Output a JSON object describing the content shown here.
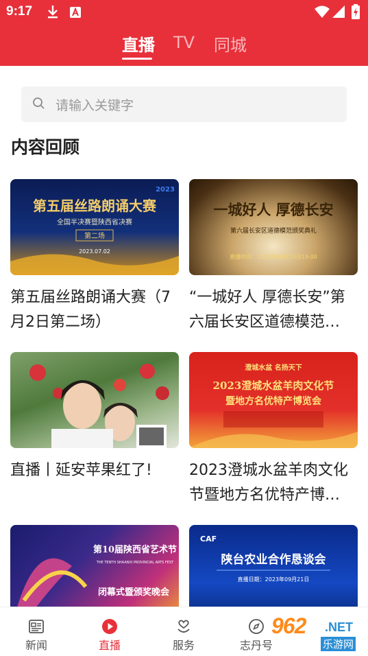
{
  "status_bar": {
    "time": "9:17"
  },
  "tabs": [
    {
      "label": "直播",
      "active": true
    },
    {
      "label": "TV",
      "active": false
    },
    {
      "label": "同城",
      "active": false
    }
  ],
  "search": {
    "placeholder": "请输入关键字"
  },
  "section": {
    "title": "内容回顾"
  },
  "cards": [
    {
      "title": "第五届丝路朗诵大赛（7月2日第二场）",
      "thumb_text": [
        "第五届丝路朗诵大赛",
        "全国半决赛暨陕西省决赛",
        "第二场",
        "2023.07.02",
        "2023"
      ]
    },
    {
      "title": "“一城好人 厚德长安”第六届长安区道德模范…",
      "thumb_text": [
        "一城好人 厚德长安",
        "第六届长安区道德模范颁奖典礼",
        "直播时间：2023年10月13日19:00"
      ]
    },
    {
      "title": "直播丨延安苹果红了!",
      "thumb_text": []
    },
    {
      "title": "2023澄城水盆羊肉文化节暨地方名优特产博…",
      "thumb_text": [
        "澄城水盆 名扬天下",
        "2023澄城水盆羊肉文化节",
        "暨地方名优特产博览会"
      ]
    },
    {
      "title": "",
      "thumb_text": [
        "第10届陕西省艺术节",
        "THE TENTH SHAANXI PROVINCIAL ARTS FEST",
        "闭幕式暨颁奖晚会"
      ]
    },
    {
      "title": "",
      "thumb_text": [
        "CAF",
        "陕台农业合作恳谈会",
        "直播日期：2023年09月21日"
      ]
    }
  ],
  "bottom_nav": [
    {
      "label": "新闻",
      "icon": "newspaper-icon",
      "active": false
    },
    {
      "label": "直播",
      "icon": "play-icon",
      "active": true
    },
    {
      "label": "服务",
      "icon": "service-icon",
      "active": false
    },
    {
      "label": "志丹号",
      "icon": "compass-icon",
      "active": false
    }
  ],
  "watermark": {
    "num": "962",
    "net": ".NET",
    "sub": "乐游网"
  },
  "colors": {
    "brand_red": "#e8303a",
    "text_dark": "#222222",
    "placeholder": "#9a9a9a"
  }
}
